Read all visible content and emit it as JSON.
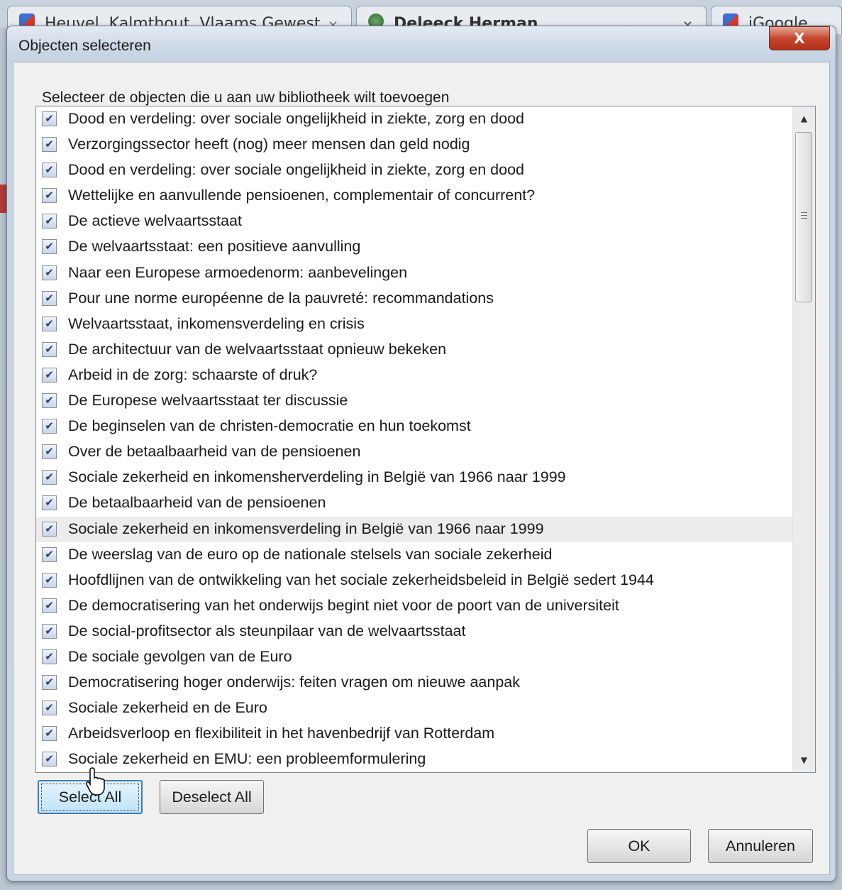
{
  "background_tabs": [
    {
      "label": "Heuvel, Kalmthout, Vlaams Gewest",
      "close": "×"
    },
    {
      "label": "Deleeck Herman",
      "close": "×"
    },
    {
      "label": "iGoogle",
      "close": ""
    }
  ],
  "dialog": {
    "title": "Objecten selecteren",
    "close_glyph": "X",
    "prompt": "Selecteer de objecten die u aan uw bibliotheek wilt toevoegen"
  },
  "items": [
    {
      "label": "Dood en verdeling: over sociale ongelijkheid in ziekte, zorg en dood",
      "checked": true
    },
    {
      "label": "Verzorgingssector heeft (nog) meer mensen dan geld nodig",
      "checked": true
    },
    {
      "label": "Dood en verdeling: over sociale ongelijkheid in ziekte, zorg en dood",
      "checked": true
    },
    {
      "label": "Wettelijke en aanvullende pensioenen, complementair of concurrent?",
      "checked": true
    },
    {
      "label": "De actieve welvaartsstaat",
      "checked": true
    },
    {
      "label": "De welvaartsstaat: een positieve aanvulling",
      "checked": true
    },
    {
      "label": "Naar een Europese armoedenorm: aanbevelingen",
      "checked": true
    },
    {
      "label": "Pour une norme européenne de la pauvreté: recommandations",
      "checked": true
    },
    {
      "label": "Welvaartsstaat, inkomensverdeling en crisis",
      "checked": true
    },
    {
      "label": "De architectuur van de welvaartsstaat opnieuw bekeken",
      "checked": true
    },
    {
      "label": "Arbeid in de zorg: schaarste of druk?",
      "checked": true
    },
    {
      "label": "De Europese welvaartsstaat ter discussie",
      "checked": true
    },
    {
      "label": "De beginselen van de christen-democratie en hun toekomst",
      "checked": true
    },
    {
      "label": "Over de betaalbaarheid van de pensioenen",
      "checked": true
    },
    {
      "label": "Sociale zekerheid en inkomensherverdeling in België van 1966 naar 1999",
      "checked": true
    },
    {
      "label": "De betaalbaarheid van de pensioenen",
      "checked": true
    },
    {
      "label": "Sociale zekerheid en inkomensverdeling in België van 1966 naar 1999",
      "checked": true,
      "highlighted": true
    },
    {
      "label": "De weerslag van de euro op de nationale stelsels van sociale zekerheid",
      "checked": true
    },
    {
      "label": "Hoofdlijnen van de ontwikkeling van het sociale zekerheidsbeleid in België sedert 1944",
      "checked": true
    },
    {
      "label": "De democratisering van het onderwijs begint niet voor de poort van de universiteit",
      "checked": true
    },
    {
      "label": "De social-profitsector als steunpilaar van de welvaartsstaat",
      "checked": true
    },
    {
      "label": "De sociale gevolgen van de Euro",
      "checked": true
    },
    {
      "label": "Democratisering hoger onderwijs: feiten vragen om nieuwe aanpak",
      "checked": true
    },
    {
      "label": "Sociale zekerheid en de Euro",
      "checked": true
    },
    {
      "label": "Arbeidsverloop en flexibiliteit in het havenbedrijf van Rotterdam",
      "checked": true
    },
    {
      "label": "Sociale zekerheid en EMU: een probleemformulering",
      "checked": true
    }
  ],
  "buttons": {
    "select_all": "Select All",
    "deselect_all": "Deselect All",
    "ok": "OK",
    "cancel": "Annuleren"
  },
  "icons": {
    "check": "check-icon",
    "scroll_up": "scroll-up-arrow-icon",
    "scroll_down": "scroll-down-arrow-icon",
    "cursor": "mouse-pointer-icon"
  },
  "colors": {
    "close_button": "#c7462d",
    "highlight_row": "#ececec",
    "focus_border": "#3c7fb1"
  }
}
